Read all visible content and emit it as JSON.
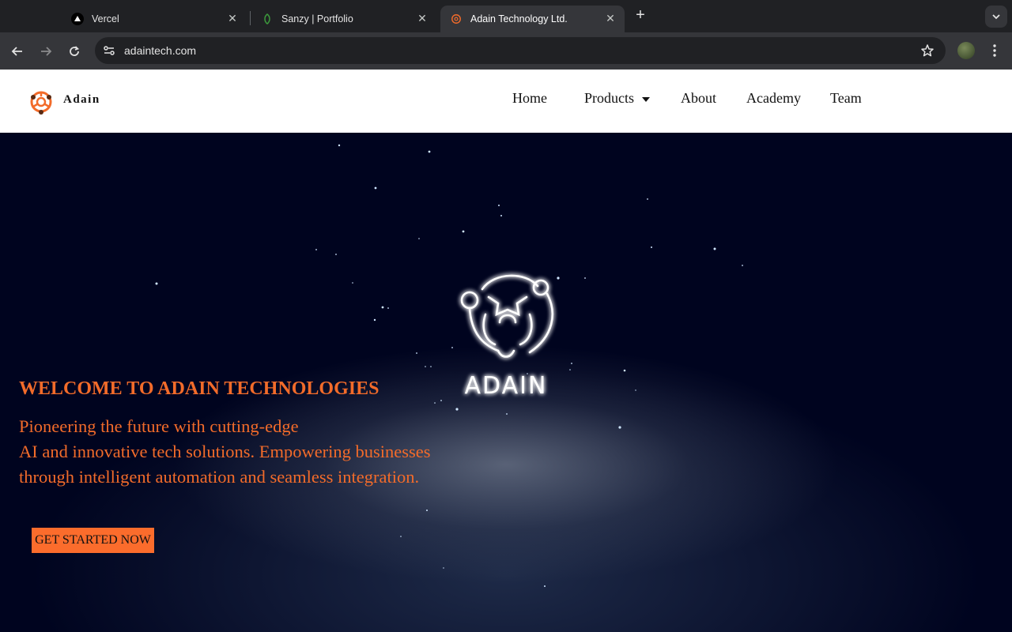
{
  "browser": {
    "tabs": [
      {
        "title": "Vercel",
        "icon": "vercel-icon"
      },
      {
        "title": "Sanzy | Portfolio",
        "icon": "leaf-icon"
      },
      {
        "title": "Adain Technology Ltd.",
        "icon": "adain-logo-icon",
        "active": true
      }
    ],
    "url": "adaintech.com"
  },
  "site": {
    "brand": "Adain",
    "nav": {
      "home": "Home",
      "products": "Products",
      "about": "About",
      "academy": "Academy",
      "team": "Team"
    },
    "emblem_text": "ADAIN",
    "hero": {
      "title": "WELCOME TO ADAIN TECHNOLOGIES",
      "lines": [
        "Pioneering the future with cutting-edge",
        "AI and innovative tech solutions. Empowering businesses",
        "through intelligent automation and seamless integration."
      ],
      "cta": "GET STARTED NOW"
    }
  },
  "colors": {
    "accent": "#f26b2a",
    "hero_bg": "#00041f",
    "chrome_dark": "#202124",
    "chrome_mid": "#35363a"
  }
}
